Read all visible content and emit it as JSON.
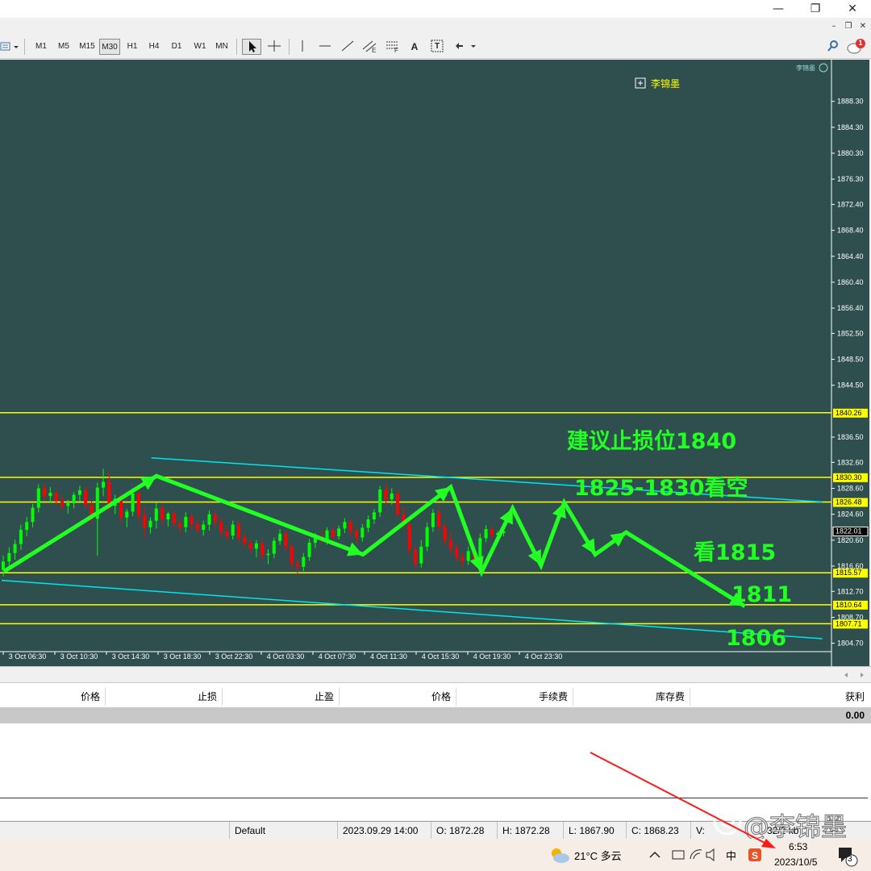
{
  "window": {
    "minimize_glyph": "—",
    "restore_glyph": "❐",
    "close_glyph": "✕"
  },
  "mdi": {
    "minimize_glyph": "–",
    "restore_glyph": "❐",
    "close_glyph": "✕"
  },
  "toolbar": {
    "timeframes": [
      "M1",
      "M5",
      "M15",
      "M30",
      "H1",
      "H4",
      "D1",
      "W1",
      "MN"
    ],
    "selected_timeframe": "M30",
    "text_tool_label": "A",
    "text_label_tool_label": "T",
    "notification_count": "1"
  },
  "chart": {
    "watermark": "李锦墨",
    "legend_label": "李锦墨",
    "annotations": {
      "stop_loss": "建议止损位1840",
      "short_zone": "1825-1830看空",
      "target_1815": "看1815",
      "target_1811": "1811",
      "target_1806": "1806"
    },
    "colors": {
      "background": "#2f4f4f",
      "level_line": "#ffff00",
      "trend_line": "#00e5ee",
      "arrow": "#22ff22",
      "bull_candle": "#00ff00",
      "bear_candle": "#ff0000",
      "axis_text": "#ffffff"
    }
  },
  "chart_data": {
    "type": "candlestick",
    "symbol_period": "M30",
    "y_ticks": [
      1888.3,
      1884.3,
      1880.3,
      1876.3,
      1872.4,
      1868.4,
      1864.4,
      1860.4,
      1856.4,
      1852.5,
      1848.5,
      1844.5,
      1836.5,
      1832.6,
      1828.6,
      1824.6,
      1820.6,
      1816.6,
      1812.7,
      1808.7,
      1804.7
    ],
    "ylim": [
      1803.9,
      1890.5
    ],
    "x_labels": [
      "3 Oct 06:30",
      "3 Oct 10:30",
      "3 Oct 14:30",
      "3 Oct 18:30",
      "3 Oct 22:30",
      "4 Oct 03:30",
      "4 Oct 07:30",
      "4 Oct 11:30",
      "4 Oct 15:30",
      "4 Oct 19:30",
      "4 Oct 23:30"
    ],
    "price_tags": [
      {
        "value": "1840.26",
        "style": "level"
      },
      {
        "value": "1830.30",
        "style": "level"
      },
      {
        "value": "1826.48",
        "style": "level"
      },
      {
        "value": "1822.01",
        "style": "current"
      },
      {
        "value": "1815.57",
        "style": "level"
      },
      {
        "value": "1810.64",
        "style": "level"
      },
      {
        "value": "1807.71",
        "style": "level"
      }
    ],
    "horizontal_levels": [
      1840.26,
      1830.3,
      1826.48,
      1815.57,
      1810.64,
      1807.71
    ],
    "current_price": 1822.01,
    "trend_lines": [
      {
        "from": [
          2.4,
          1833.3
        ],
        "to": [
          15.4,
          1826.5
        ]
      },
      {
        "from": [
          -0.5,
          1814.4
        ],
        "to": [
          15.4,
          1805.4
        ]
      }
    ],
    "arrow_path": [
      [
        -0.45,
        1815.8
      ],
      [
        2.5,
        1830.5
      ],
      [
        6.5,
        1818.4
      ],
      [
        8.2,
        1828.8
      ],
      [
        8.8,
        1815.7
      ],
      [
        9.4,
        1825.5
      ],
      [
        9.95,
        1816.7
      ],
      [
        10.4,
        1826.4
      ],
      [
        11.0,
        1818.4
      ],
      [
        11.6,
        1821.8
      ],
      [
        13.9,
        1810.4
      ]
    ],
    "candles": [
      [
        1816.0,
        1818.2,
        1815.0,
        1817.3
      ],
      [
        1817.3,
        1819.5,
        1816.4,
        1818.6
      ],
      [
        1818.6,
        1820.7,
        1817.6,
        1820.0
      ],
      [
        1820.0,
        1823.0,
        1819.1,
        1822.2
      ],
      [
        1822.2,
        1824.2,
        1821.2,
        1823.4
      ],
      [
        1823.4,
        1826.2,
        1822.6,
        1825.6
      ],
      [
        1825.6,
        1829.2,
        1824.9,
        1828.6
      ],
      [
        1828.6,
        1829.3,
        1826.9,
        1827.4
      ],
      [
        1827.4,
        1828.8,
        1826.3,
        1827.9
      ],
      [
        1827.9,
        1828.2,
        1826.0,
        1826.6
      ],
      [
        1826.6,
        1827.5,
        1825.3,
        1825.9
      ],
      [
        1825.9,
        1826.8,
        1824.7,
        1826.3
      ],
      [
        1826.3,
        1828.0,
        1825.5,
        1827.6
      ],
      [
        1827.6,
        1829.0,
        1826.6,
        1828.3
      ],
      [
        1828.3,
        1828.9,
        1825.5,
        1826.1
      ],
      [
        1826.1,
        1826.6,
        1823.1,
        1823.9
      ],
      [
        1823.9,
        1829.5,
        1818.2,
        1828.7
      ],
      [
        1828.7,
        1831.6,
        1827.4,
        1829.6
      ],
      [
        1829.6,
        1831.0,
        1825.0,
        1825.9
      ],
      [
        1825.9,
        1827.6,
        1824.6,
        1827.0
      ],
      [
        1827.0,
        1827.7,
        1823.2,
        1824.1
      ],
      [
        1824.1,
        1825.4,
        1822.6,
        1825.0
      ],
      [
        1825.0,
        1828.6,
        1824.3,
        1827.8
      ],
      [
        1827.8,
        1828.3,
        1823.5,
        1824.4
      ],
      [
        1824.4,
        1825.6,
        1821.1,
        1822.6
      ],
      [
        1822.6,
        1824.1,
        1821.6,
        1823.6
      ],
      [
        1823.6,
        1826.4,
        1822.4,
        1825.5
      ],
      [
        1825.5,
        1826.2,
        1823.0,
        1823.8
      ],
      [
        1823.8,
        1825.0,
        1822.7,
        1824.7
      ],
      [
        1824.7,
        1825.2,
        1822.7,
        1823.2
      ],
      [
        1823.2,
        1823.9,
        1821.5,
        1822.6
      ],
      [
        1822.6,
        1824.9,
        1821.8,
        1824.2
      ],
      [
        1824.2,
        1824.7,
        1822.3,
        1823.1
      ],
      [
        1823.1,
        1823.6,
        1821.6,
        1822.2
      ],
      [
        1822.2,
        1823.6,
        1821.3,
        1823.0
      ],
      [
        1823.0,
        1825.2,
        1822.1,
        1824.6
      ],
      [
        1824.6,
        1825.2,
        1822.7,
        1823.4
      ],
      [
        1823.4,
        1824.0,
        1821.1,
        1821.9
      ],
      [
        1821.9,
        1822.6,
        1820.6,
        1821.3
      ],
      [
        1821.3,
        1823.6,
        1820.7,
        1823.0
      ],
      [
        1823.0,
        1823.6,
        1820.2,
        1821.0
      ],
      [
        1821.0,
        1821.6,
        1819.6,
        1820.1
      ],
      [
        1820.1,
        1820.8,
        1818.6,
        1819.3
      ],
      [
        1819.3,
        1820.6,
        1818.0,
        1820.1
      ],
      [
        1820.1,
        1820.6,
        1817.6,
        1818.3
      ],
      [
        1818.3,
        1819.2,
        1816.9,
        1818.5
      ],
      [
        1818.5,
        1821.0,
        1817.8,
        1820.5
      ],
      [
        1820.5,
        1822.3,
        1819.9,
        1821.6
      ],
      [
        1821.6,
        1822.1,
        1818.9,
        1819.6
      ],
      [
        1819.6,
        1820.2,
        1816.2,
        1817.0
      ],
      [
        1817.0,
        1817.7,
        1815.5,
        1816.5
      ],
      [
        1816.5,
        1818.6,
        1815.8,
        1818.0
      ],
      [
        1818.0,
        1820.8,
        1817.4,
        1820.2
      ],
      [
        1820.2,
        1821.7,
        1819.4,
        1821.1
      ],
      [
        1821.1,
        1822.0,
        1820.0,
        1820.6
      ],
      [
        1820.6,
        1822.6,
        1819.9,
        1822.1
      ],
      [
        1822.1,
        1822.8,
        1820.6,
        1821.2
      ],
      [
        1821.2,
        1822.9,
        1820.7,
        1822.4
      ],
      [
        1822.4,
        1824.0,
        1821.7,
        1823.4
      ],
      [
        1823.4,
        1823.8,
        1821.3,
        1822.0
      ],
      [
        1822.0,
        1822.5,
        1820.2,
        1821.0
      ],
      [
        1821.0,
        1823.1,
        1820.4,
        1822.5
      ],
      [
        1822.5,
        1824.4,
        1821.8,
        1823.8
      ],
      [
        1823.8,
        1825.4,
        1823.1,
        1824.9
      ],
      [
        1824.9,
        1829.0,
        1824.2,
        1828.4
      ],
      [
        1828.4,
        1829.3,
        1826.1,
        1826.9
      ],
      [
        1826.9,
        1828.6,
        1826.1,
        1827.8
      ],
      [
        1827.8,
        1828.4,
        1824.1,
        1824.6
      ],
      [
        1824.6,
        1825.6,
        1822.4,
        1823.0
      ],
      [
        1823.0,
        1823.6,
        1818.4,
        1819.2
      ],
      [
        1819.2,
        1819.6,
        1816.2,
        1817.0
      ],
      [
        1817.0,
        1820.6,
        1816.4,
        1819.6
      ],
      [
        1819.6,
        1823.3,
        1818.9,
        1822.6
      ],
      [
        1822.6,
        1825.4,
        1821.9,
        1824.8
      ],
      [
        1824.8,
        1825.6,
        1822.0,
        1822.7
      ],
      [
        1822.7,
        1823.3,
        1819.8,
        1820.6
      ],
      [
        1820.6,
        1822.0,
        1818.6,
        1819.4
      ],
      [
        1819.4,
        1820.0,
        1817.3,
        1818.0
      ],
      [
        1818.0,
        1818.6,
        1816.4,
        1817.4
      ],
      [
        1817.4,
        1819.6,
        1816.8,
        1818.9
      ],
      [
        1818.9,
        1819.4,
        1816.6,
        1817.6
      ],
      [
        1817.6,
        1821.6,
        1817.1,
        1820.9
      ],
      [
        1820.9,
        1822.9,
        1820.3,
        1822.3
      ],
      [
        1822.3,
        1822.7,
        1820.8,
        1821.4
      ],
      [
        1821.4,
        1822.0,
        1820.9,
        1821.7
      ],
      [
        1821.7,
        1822.4,
        1821.2,
        1822.0
      ]
    ]
  },
  "terminal": {
    "columns": [
      "价格",
      "止损",
      "止盈",
      "价格",
      "手续费",
      "库存费",
      "获利"
    ],
    "total_profit": "0.00"
  },
  "status": {
    "profile": "Default",
    "time": "2023.09.29 14:00",
    "open": "O: 1872.28",
    "high": "H: 1872.28",
    "low": "L: 1867.90",
    "close": "C: 1868.23",
    "volume": "V:",
    "traffic": "32/2 kb"
  },
  "watermark": {
    "text": "@李锦墨"
  },
  "taskbar": {
    "weather": "21°C  多云",
    "ime": "中",
    "time": "6:53",
    "date": "2023/10/5",
    "notifications": "3"
  }
}
